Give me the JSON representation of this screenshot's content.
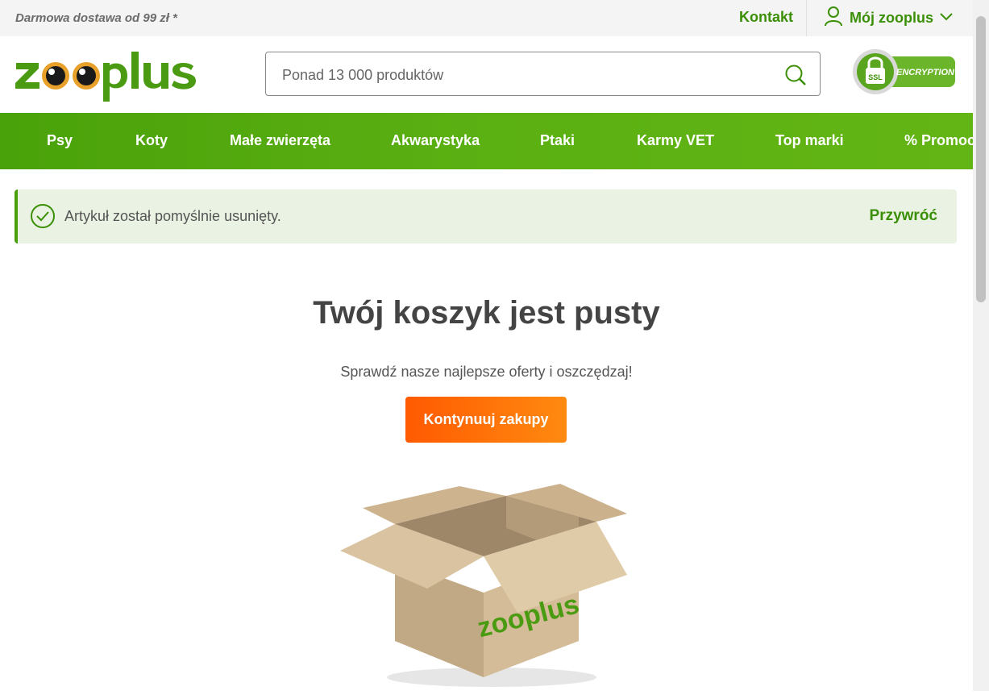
{
  "topbar": {
    "promo": "Darmowa dostawa od 99 zł *",
    "contact": "Kontakt",
    "account": "Mój zooplus"
  },
  "header": {
    "logo_text": "zooplus",
    "search_placeholder": "Ponad 13 000 produktów",
    "ssl_badge": "ENCRYPTION",
    "ssl_lock": "SSL"
  },
  "nav": {
    "items": [
      "Psy",
      "Koty",
      "Małe zwierzęta",
      "Akwarystyka",
      "Ptaki",
      "Karmy VET",
      "Top marki",
      "% Promocje"
    ]
  },
  "alert": {
    "message": "Artykuł został pomyślnie usunięty.",
    "action": "Przywróć"
  },
  "cart": {
    "title": "Twój koszyk jest pusty",
    "subtitle": "Sprawdź nasze najlepsze oferty i oszczędzaj!",
    "button": "Kontynuuj zakupy",
    "box_logo": "zooplus"
  },
  "colors": {
    "brand_green": "#3a8f06",
    "nav_green": "#5bb012",
    "cta_orange": "#ff6a00"
  },
  "icons": [
    "user-icon",
    "chevron-down-icon",
    "search-icon",
    "check-circle-icon",
    "ssl-lock-icon"
  ]
}
